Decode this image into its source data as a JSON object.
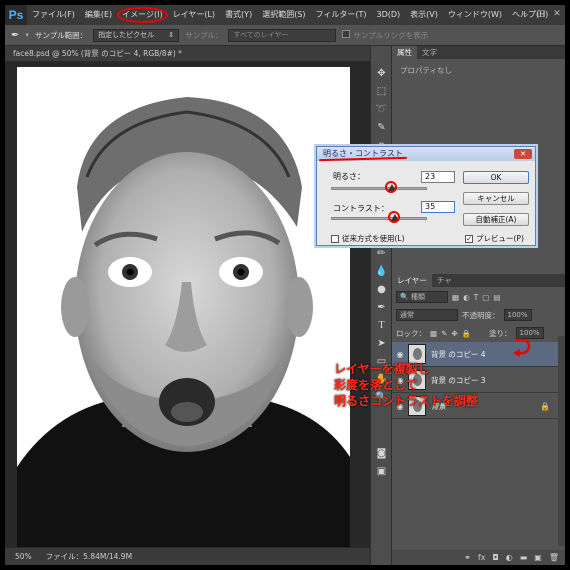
{
  "app": {
    "logo": "Ps"
  },
  "menubar": {
    "items": [
      "ファイル(F)",
      "編集(E)",
      "イメージ(I)",
      "レイヤー(L)",
      "書式(Y)",
      "選択範囲(S)",
      "フィルター(T)",
      "3D(D)",
      "表示(V)",
      "ウィンドウ(W)",
      "ヘルプ(H)"
    ],
    "circled_item": "イメージ(I)"
  },
  "options": {
    "sample_label": "サンプル範囲：",
    "sample_value": "指定したピクセル",
    "sample2_label": "サンプル：",
    "sample2_value": "すべてのレイヤー",
    "ring_label": "サンプルリングを表示"
  },
  "document": {
    "tab_title": "face8.psd @ 50% (背景 のコピー 4, RGB/8#) *",
    "zoom": "50%",
    "file_info": "ファイル：5.84M/14.9M"
  },
  "properties": {
    "tabs": [
      "属性",
      "文字"
    ],
    "empty_text": "プロパティなし"
  },
  "layers": {
    "tabs": [
      "レイヤー",
      "チャ"
    ],
    "filter_label": "種類",
    "blend_mode": "通常",
    "opacity_label": "不透明度：",
    "opacity_value": "100%",
    "lock_label": "ロック：",
    "fill_label": "塗り：",
    "fill_value": "100%",
    "items": [
      {
        "name": "背景 のコピー 4",
        "selected": true,
        "visible": true
      },
      {
        "name": "背景 のコピー 3",
        "selected": false,
        "visible": true
      },
      {
        "name": "背景",
        "selected": false,
        "visible": true,
        "locked": true
      }
    ]
  },
  "dialog": {
    "title": "明るさ・コントラスト",
    "brightness_label": "明るさ：",
    "brightness_value": "23",
    "brightness_level": 0.62,
    "contrast_label": "コントラスト：",
    "contrast_value": "35",
    "contrast_level": 0.66,
    "ok_label": "OK",
    "cancel_label": "キャンセル",
    "auto_label": "自動補正(A)",
    "legacy_label": "従来方式を使用(L)",
    "legacy_checked": false,
    "preview_label": "プレビュー(P)",
    "preview_checked": true
  },
  "annotation": {
    "lines": [
      "レイヤーを複製し",
      "彩度を落として",
      "明るさコントラストを調整"
    ],
    "color": "#ff2a1a"
  },
  "colors": {
    "accent": "#4cb2ff",
    "selection": "#5b6a80",
    "annotation": "#ff2a1a"
  }
}
